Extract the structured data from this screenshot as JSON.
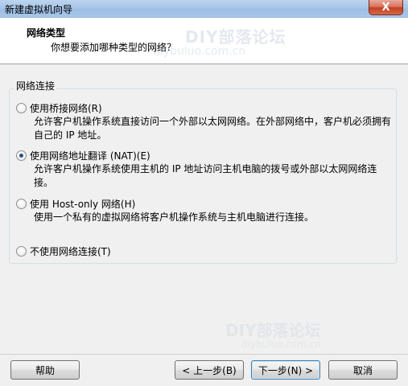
{
  "window": {
    "title": "新建虚拟机向导",
    "close_glyph": "X"
  },
  "header": {
    "title": "网络类型",
    "subtitle": "你想要添加哪种类型的网络？",
    "watermark": "DIY部落论坛",
    "watermark_url": "diybuluo.com.cn"
  },
  "group": {
    "label": "网络连接",
    "options": [
      {
        "label": "使用桥接网络(R)",
        "description": "允许客户机操作系统直接访问一个外部以太网网络。在外部网络中，客户机必须拥有自己的 IP 地址。",
        "selected": false
      },
      {
        "label": "使用网络地址翻译 (NAT)(E)",
        "description": "允许客户机操作系统使用主机的 IP 地址访问主机电脑的拨号或外部以太网网络连接。",
        "selected": true
      },
      {
        "label": "使用 Host-only 网络(H)",
        "description": "使用一个私有的虚拟网络将客户机操作系统与主机电脑进行连接。",
        "selected": false
      },
      {
        "label": "不使用网络连接(T)",
        "description": "",
        "selected": false
      }
    ]
  },
  "watermark_bottom": {
    "text": "DIY部落论坛",
    "url": "diybuluo.com.cn"
  },
  "buttons": {
    "help": "帮助",
    "back": "< 上一步(B)",
    "next": "下一步(N) >",
    "cancel": "取消"
  },
  "colors": {
    "titlebar": "#a9c6e8",
    "close": "#c2401f",
    "radio_dot": "#2a4e8c"
  }
}
